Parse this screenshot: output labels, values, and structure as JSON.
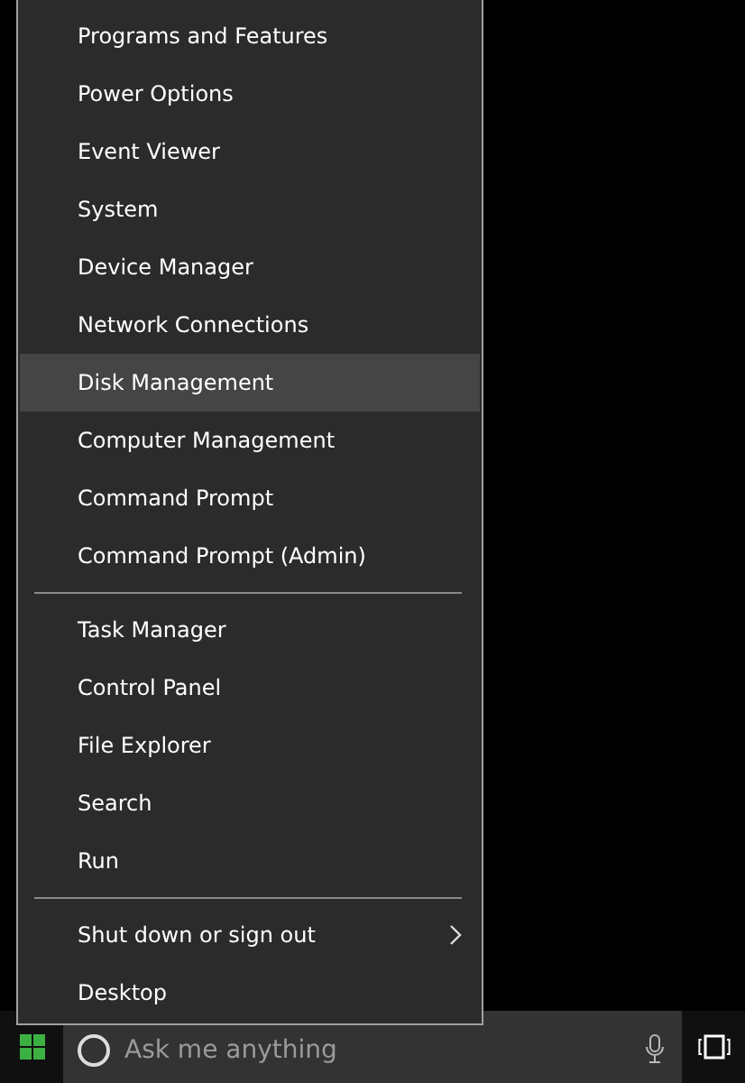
{
  "menu": {
    "groups": [
      {
        "items": [
          {
            "label": "Programs and Features",
            "selected": false,
            "has_submenu": false
          },
          {
            "label": "Power Options",
            "selected": false,
            "has_submenu": false
          },
          {
            "label": "Event Viewer",
            "selected": false,
            "has_submenu": false
          },
          {
            "label": "System",
            "selected": false,
            "has_submenu": false
          },
          {
            "label": "Device Manager",
            "selected": false,
            "has_submenu": false
          },
          {
            "label": "Network Connections",
            "selected": false,
            "has_submenu": false
          },
          {
            "label": "Disk Management",
            "selected": true,
            "has_submenu": false
          },
          {
            "label": "Computer Management",
            "selected": false,
            "has_submenu": false
          },
          {
            "label": "Command Prompt",
            "selected": false,
            "has_submenu": false
          },
          {
            "label": "Command Prompt (Admin)",
            "selected": false,
            "has_submenu": false
          }
        ]
      },
      {
        "items": [
          {
            "label": "Task Manager",
            "selected": false,
            "has_submenu": false
          },
          {
            "label": "Control Panel",
            "selected": false,
            "has_submenu": false
          },
          {
            "label": "File Explorer",
            "selected": false,
            "has_submenu": false
          },
          {
            "label": "Search",
            "selected": false,
            "has_submenu": false
          },
          {
            "label": "Run",
            "selected": false,
            "has_submenu": false
          }
        ]
      },
      {
        "items": [
          {
            "label": "Shut down or sign out",
            "selected": false,
            "has_submenu": true
          },
          {
            "label": "Desktop",
            "selected": false,
            "has_submenu": false
          }
        ]
      }
    ]
  },
  "taskbar": {
    "search": {
      "placeholder": "Ask me anything"
    }
  }
}
